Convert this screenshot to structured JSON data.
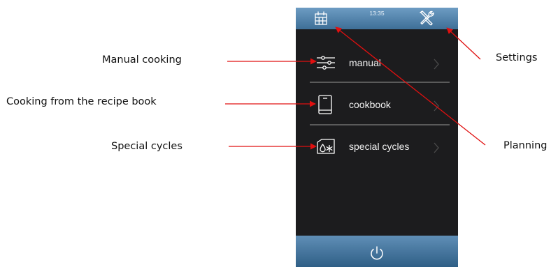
{
  "callouts": {
    "manual_cooking": "Manual cooking",
    "recipe_book": "Cooking from the recipe book",
    "special_cycles": "Special cycles",
    "settings": "Settings",
    "planning": "Planning"
  },
  "screen": {
    "clock": "13:35",
    "menu": [
      {
        "label": "manual",
        "icon": "sliders-icon"
      },
      {
        "label": "cookbook",
        "icon": "book-icon"
      },
      {
        "label": "special cycles",
        "icon": "special-cycles-icon"
      }
    ],
    "top_icons": [
      "calendar-icon",
      "tools-icon"
    ],
    "bottom_icon": "power-icon"
  },
  "colors": {
    "arrow": "#e01010",
    "screen_background": "#1c1c1e",
    "bar_top": "#6d9cc3",
    "bar_bottom": "#2f5f86"
  }
}
